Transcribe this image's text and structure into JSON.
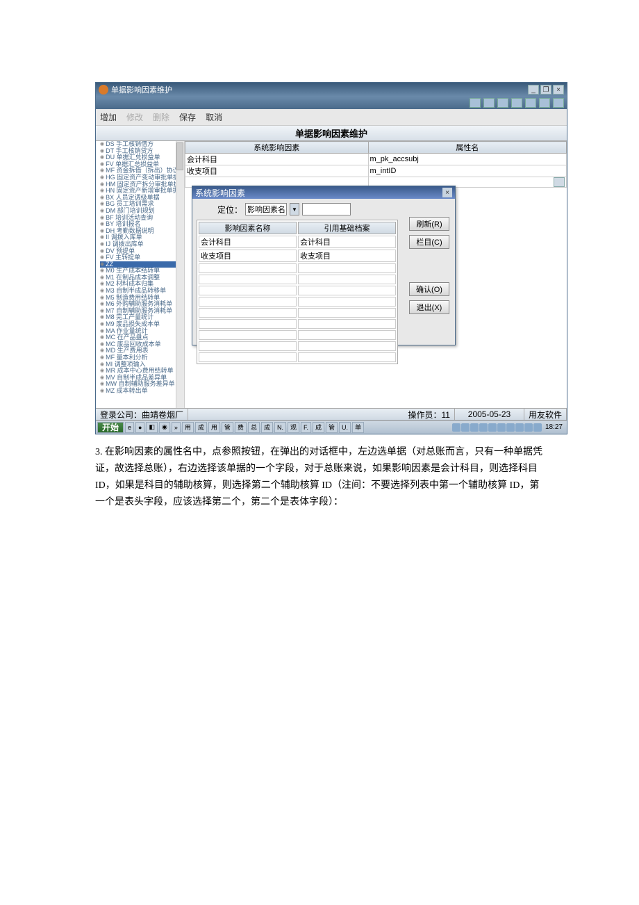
{
  "window": {
    "title": "单据影响因素维护"
  },
  "menu": {
    "add": "增加",
    "edit": "修改",
    "del": "删除",
    "save": "保存",
    "cancel": "取消"
  },
  "header": "单据影响因素维护",
  "tree": {
    "items": [
      "DS 手工核销借方",
      "DT 手工核销贷方",
      "DU 单据汇兑损益单",
      "FV 单据汇总损益单",
      "MF 资金拆借（拆出）协议",
      "HG 固定资产变动审批单据",
      "HM 固定资产拆分审批单据",
      "HN 固定资产新增审批单据",
      "BX 人员定调级单据",
      "BG 员工培训需求",
      "DM 部门培训规划",
      "BF 培训活动查询",
      "BY 培训报名",
      "DH 考勤数据说明",
      "II 调拨入库单",
      "IJ 调拨出库单",
      "DV 预提单",
      "FV 主转提单",
      "ZZ",
      "M0 生产成本结转单",
      "M1 在制品成本调整",
      "M2 材料成本归集",
      "M3 自制半成品转移单",
      "M5 制造费用结转单",
      "M6 外购辅助服务消耗单",
      "M7 自制辅助服务消耗单",
      "M8 完工产量统计",
      "M9 废品损失成本单",
      "MA 作业量统计",
      "MC 在产品盘点",
      "MC 废品回收成本单",
      "MD 生产费用表",
      "MF 量本利分析",
      "MI 调整项输入",
      "MR 成本中心费用结转单",
      "MV 自制半成品差异单",
      "MW 自制辅助服务差异单",
      "MZ 成本转出单"
    ],
    "selected": 18
  },
  "grid": {
    "h1": "系统影响因素",
    "h2": "属性名",
    "rows": [
      {
        "a": "会计科目",
        "b": "m_pk_accsubj"
      },
      {
        "a": "收支项目",
        "b": "m_intID"
      }
    ]
  },
  "dialog": {
    "title": "系统影响因素",
    "locate": "定位：",
    "search_label": "影响因素名称",
    "col1": "影响因素名称",
    "col2": "引用基础档案",
    "rows": [
      {
        "a": "会计科目",
        "b": "会计科目"
      },
      {
        "a": "收支项目",
        "b": "收支项目"
      }
    ],
    "btn_refresh": "刷新(R)",
    "btn_col": "栏目(C)",
    "btn_ok": "确认(O)",
    "btn_exit": "退出(X)"
  },
  "status": {
    "company": "登录公司：曲靖卷烟厂",
    "operator": "操作员：11",
    "date": "2005-05-23",
    "vendor": "用友软件"
  },
  "taskbar": {
    "start": "开始",
    "items": [
      "用",
      "成",
      "用",
      "管",
      "费",
      "总",
      "成",
      "N.",
      "观",
      "F.",
      "成",
      "管",
      "U.",
      "单"
    ],
    "time": "18:27"
  },
  "doc": "3. 在影响因素的属性名中，点参照按钮，在弹出的对话框中，左边选单据（对总账而言，只有一种单据凭证，故选择总账），右边选择该单据的一个字段，对于总账来说，如果影响因素是会计科目，则选择科目 ID，如果是科目的辅助核算，则选择第二个辅助核算 ID（注间：不要选择列表中第一个辅助核算 ID，第一个是表头字段，应该选择第二个，第二个是表体字段）："
}
